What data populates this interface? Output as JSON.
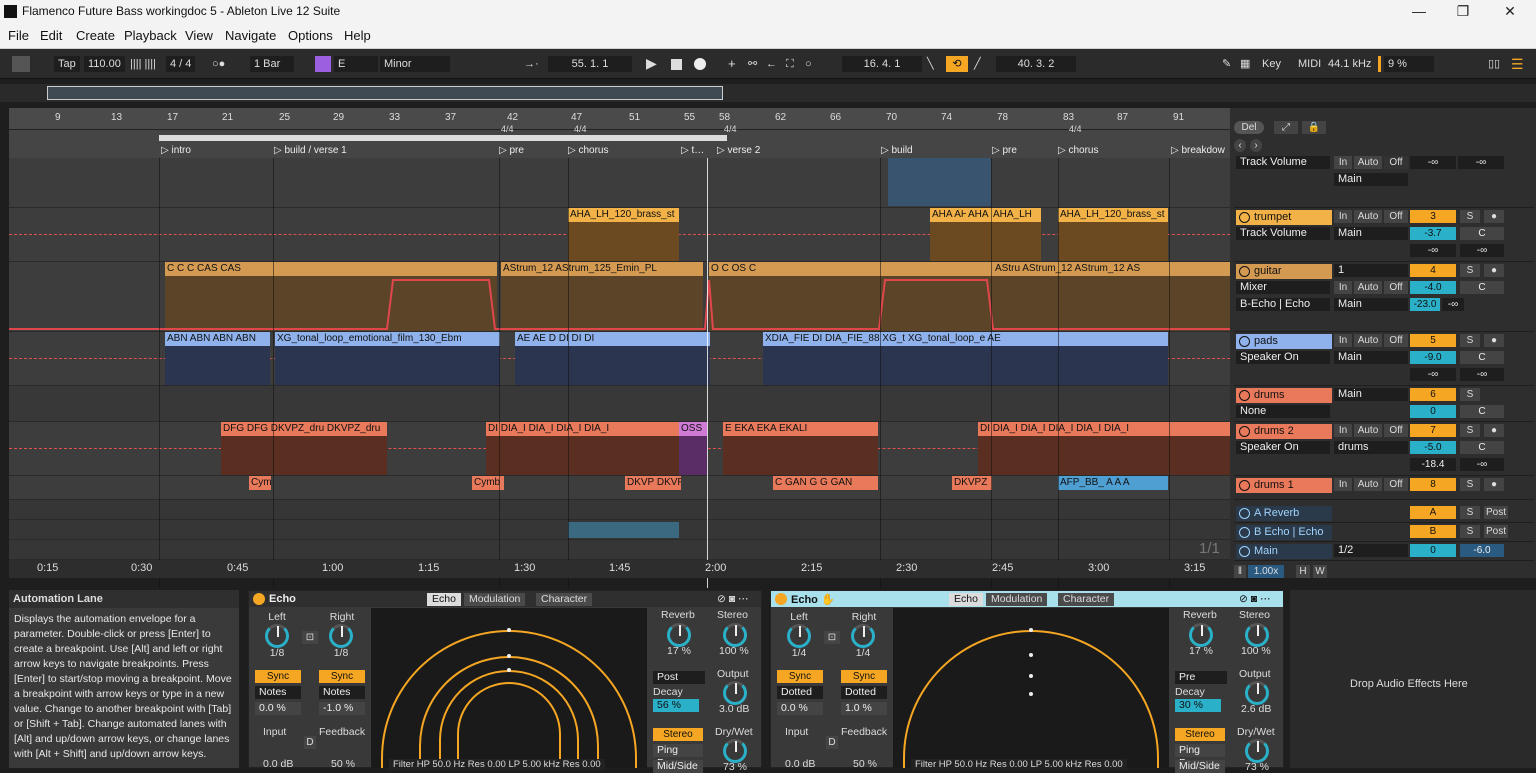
{
  "window": {
    "title": "Flamenco Future Bass workingdoc 5 - Ableton Live 12 Suite",
    "minimize": "—",
    "restore": "❐",
    "close": "✕"
  },
  "menu": [
    "File",
    "Edit",
    "Create",
    "Playback",
    "View",
    "Navigate",
    "Options",
    "Help"
  ],
  "transport": {
    "tap": "Tap",
    "tempo": "110.00",
    "sig": "4 / 4",
    "quant": "1 Bar",
    "root": "E",
    "scale": "Minor",
    "arr_pos": "55.   1.   1",
    "loop_start": "16.   4.   1",
    "loop_len": "40.   3.   2",
    "key": "Key",
    "midi": "MIDI",
    "sample_rate": "44.1 kHz",
    "cpu": "9 %"
  },
  "ruler": {
    "bars": [
      "9",
      "13",
      "17",
      "21",
      "25",
      "29",
      "33",
      "37",
      "42",
      "47",
      "51",
      "55",
      "58",
      "62",
      "66",
      "70",
      "74",
      "78",
      "83",
      "87",
      "91"
    ],
    "sigs": [
      "4/4",
      "4/4",
      "4/4",
      "4/4"
    ]
  },
  "locators": [
    "intro",
    "build / verse 1",
    "pre",
    "chorus",
    "t…",
    "verse 2",
    "build",
    "pre",
    "chorus",
    "breakdow"
  ],
  "times": [
    "0:15",
    "0:30",
    "0:45",
    "1:00",
    "1:15",
    "1:30",
    "1:45",
    "2:00",
    "2:15",
    "2:30",
    "2:45",
    "3:00",
    "3:15"
  ],
  "clips": {
    "trumpet": [
      "AHA_LH_120_brass_st",
      "AHA AH",
      "AHA",
      "AHA_LH",
      "AHA_LH_120_brass_st"
    ],
    "guitar": [
      "C",
      "C",
      "C",
      "CAS",
      "CAS",
      "C",
      "C",
      "C",
      "C",
      "C",
      "C",
      "C",
      "C",
      "C",
      "C",
      "C",
      "C",
      "C",
      "AStrum_12",
      "AStrum_125_Emin_PL",
      "C",
      "O",
      "C",
      "OS",
      "C",
      "C",
      "C",
      "C",
      "O",
      "C",
      "C",
      "C",
      "C",
      "C",
      "C",
      "AStru",
      "AStru",
      "AStrum_12",
      "AStrum_12",
      "A",
      "A",
      "AS"
    ],
    "pads": [
      "ABN",
      "ABN",
      "ABN",
      "ABN",
      "XG_tonal_loop_emotional_film_130_Ebm",
      "AE",
      "AE",
      "D",
      "DI",
      "DI",
      "DI",
      "DI",
      "DI",
      "A",
      "A",
      "XDIA_FIE",
      "DI",
      "DIA_FIE_88",
      "XG_t",
      "XG_tonal_loop_e",
      "AE",
      "AE",
      "D",
      "DI",
      "DI",
      "DI",
      "DI",
      "DI",
      "DI",
      "DI"
    ],
    "drums2": [
      "DFG",
      "DFG",
      "DKVPZ_dru",
      "DKVPZ_dru",
      "DI",
      "DIA_I",
      "DIA_I",
      "DIA_I",
      "DIA_I",
      "DIA_I",
      "DIA_I",
      "OSS",
      "E",
      "EKA",
      "EKA",
      "EKALI",
      "E",
      "EKA",
      "E",
      "DI",
      "DIA_I",
      "DIA_I",
      "DIA_I",
      "DIA_I",
      "DIA_I",
      "DIA_I",
      "DIA_I",
      "DIA_I"
    ],
    "drums1": [
      "Cym",
      "Cymb",
      "DKVP",
      "DKVP",
      "C",
      "GAN",
      "G",
      "G",
      "GAN",
      "G",
      "DKVPZ",
      "AFP_BB_",
      "A",
      "A",
      "A",
      "A",
      "A",
      "A"
    ]
  },
  "mixer": {
    "del": "Del",
    "top_track": {
      "param": "Track Volume",
      "in": "In",
      "auto": "Auto",
      "off": "Off",
      "out": "Main",
      "vol": "-∞",
      "pan": "-∞"
    },
    "tracks": [
      {
        "name": "trumpet",
        "param": "Track Volume",
        "out": "Main",
        "num": "3",
        "vol": "-3.7",
        "pan": "C",
        "peak1": "-∞",
        "peak2": "-∞"
      },
      {
        "name": "guitar",
        "sub": "Mixer",
        "param2": "B-Echo | Echo",
        "chan": "1",
        "out": "Main",
        "num": "4",
        "vol": "-4.0",
        "pan": "C",
        "peak1": "-23.0",
        "peak2": "-∞"
      },
      {
        "name": "pads",
        "param": "Speaker On",
        "out": "Main",
        "num": "5",
        "vol": "-9.0",
        "pan": "C",
        "peak1": "-∞",
        "peak2": "-∞"
      },
      {
        "name": "drums",
        "param": "None",
        "out": "Main",
        "num": "6",
        "vol": "0",
        "pan": "C"
      },
      {
        "name": "drums 2",
        "param": "Speaker On",
        "out": "drums",
        "num": "7",
        "vol": "-5.0",
        "pan": "C",
        "peak1": "-18.4",
        "peak2": "-∞"
      },
      {
        "name": "drums 1",
        "num": "8"
      }
    ],
    "returns": [
      {
        "name": "A Reverb",
        "letter": "A",
        "post": "Post"
      },
      {
        "name": "B Echo | Echo",
        "letter": "B",
        "post": "Post"
      }
    ],
    "main": {
      "name": "Main",
      "out": "1/2",
      "num": "0",
      "vol": "-6.0"
    },
    "page": "1/1",
    "zoom": "1.00x",
    "h": "H",
    "w": "W",
    "labels": {
      "in": "In",
      "auto": "Auto",
      "off": "Off",
      "s": "S"
    }
  },
  "info": {
    "title": "Automation Lane",
    "text": "Displays the automation envelope for a parameter. Double-click or press [Enter] to create a breakpoint. Use [Alt] and left or right arrow keys to navigate breakpoints. Press [Enter] to start/stop moving a breakpoint. Move a breakpoint with arrow keys or type in a new value. Change to another breakpoint with [Tab] or [Shift + Tab]. Change automated  lanes with [Alt] and up/down arrow keys, or change lanes with [Alt + Shift] and up/down arrow keys."
  },
  "echo1": {
    "name": "Echo",
    "tabs": [
      "Echo",
      "Modulation",
      "Character"
    ],
    "left": "Left",
    "right": "Right",
    "lval": "1/8",
    "rval": "1/8",
    "sync": "Sync",
    "mode": "Notes",
    "loff": "0.0 %",
    "roff": "-1.0 %",
    "input": "Input",
    "feedback": "Feedback",
    "d": "D",
    "reverb": "Reverb",
    "rev_val": "17 %",
    "stereo": "Stereo",
    "st_val": "100 %",
    "post": "Post",
    "decay": "Decay",
    "decay_val": "56 %",
    "output": "Output",
    "out_val": "3.0 dB",
    "stereo_btn": "Stereo",
    "pingpong": "Ping Pong",
    "midside": "Mid/Side",
    "drywet": "Dry/Wet",
    "filter": "Filter HP  50.0 Hz   Res  0.00  LP  5.00 kHz  Res  0.00",
    "in_val": "0.0 dB",
    "fb_val": "50 %",
    "dw_val": "73 %"
  },
  "echo2": {
    "name": "Echo",
    "tabs": [
      "Echo",
      "Modulation",
      "Character"
    ],
    "left": "Left",
    "right": "Right",
    "lval": "1/4",
    "rval": "1/4",
    "sync": "Sync",
    "mode": "Dotted",
    "loff": "0.0 %",
    "roff": "1.0 %",
    "input": "Input",
    "feedback": "Feedback",
    "d": "D",
    "reverb": "Reverb",
    "rev_val": "17 %",
    "stereo": "Stereo",
    "st_val": "100 %",
    "post": "Pre",
    "decay": "Decay",
    "decay_val": "30 %",
    "output": "Output",
    "out_val": "2.6 dB",
    "stereo_btn": "Stereo",
    "pingpong": "Ping Pong",
    "midside": "Mid/Side",
    "drywet": "Dry/Wet",
    "filter": "Filter HP  50.0 Hz   Res  0.00  LP  5.00 kHz  Res  0.00",
    "in_val": "0.0 dB",
    "fb_val": "50 %",
    "dw_val": "73 %"
  },
  "dropzone": "Drop Audio Effects Here"
}
